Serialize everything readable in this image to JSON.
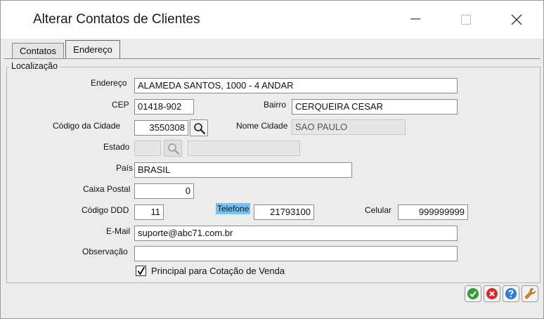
{
  "window": {
    "title": "Alterar Contatos de Clientes",
    "minimize_glyph": "—",
    "maximize_glyph": "☐",
    "close_glyph": "✕"
  },
  "tabs": [
    {
      "label": "Contatos",
      "active": false
    },
    {
      "label": "Endereço",
      "active": true
    }
  ],
  "section": {
    "title": "Localização"
  },
  "fields": {
    "endereco": {
      "label": "Endereço",
      "value": "ALAMEDA SANTOS, 1000 - 4 ANDAR"
    },
    "cep": {
      "label": "CEP",
      "value": "01418-902"
    },
    "bairro": {
      "label": "Bairro",
      "value": "CERQUEIRA CESAR"
    },
    "codigo_cidade": {
      "label": "Código da Cidade",
      "value": "3550308"
    },
    "nome_cidade": {
      "label": "Nome Cidade",
      "value": "SAO PAULO"
    },
    "estado": {
      "label": "Estado",
      "value": "",
      "description": ""
    },
    "pais": {
      "label": "País",
      "value": "BRASIL"
    },
    "caixa_postal": {
      "label": "Caixa Postal",
      "value": "0"
    },
    "codigo_ddd": {
      "label": "Código DDD",
      "value": "11"
    },
    "telefone": {
      "label": "Telefone",
      "value": "21793100"
    },
    "celular": {
      "label": "Celular",
      "value": "999999999"
    },
    "email": {
      "label": "E-Mail",
      "value": "suporte@abc71.com.br"
    },
    "observacao": {
      "label": "Observação",
      "value": ""
    }
  },
  "checkbox": {
    "label": "Principal para Cotação de Venda",
    "checked": true
  },
  "icons": {
    "search": "magnifier-icon",
    "confirm": "check-icon",
    "cancel": "cancel-icon",
    "help": "help-icon",
    "tools": "wrench-icon"
  },
  "colors": {
    "highlight": "#73c3f5",
    "confirm": "#2e9e3a",
    "cancel": "#d32a2a",
    "help": "#2f7bd6",
    "tools": "#e88a1a"
  }
}
